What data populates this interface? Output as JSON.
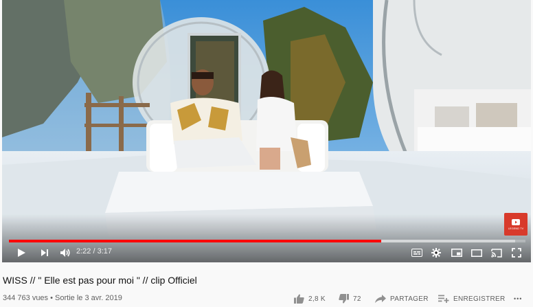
{
  "player": {
    "current_time": "2:22",
    "time_separator": " / ",
    "duration": "3:17",
    "progress_played_fraction": 0.721,
    "progress_loaded_fraction": 0.98,
    "watermark_text": "LEGEND TV"
  },
  "video": {
    "title": "WISS // \" Elle est pas pour moi \" // clip Officiel",
    "views": "344 763 vues",
    "separator": " • ",
    "release": "Sortie le 3 avr. 2019"
  },
  "actions": {
    "like_count": "2,8 K",
    "dislike_count": "72",
    "share_label": "PARTAGER",
    "save_label": "ENREGISTRER",
    "more_label": "•••"
  },
  "icons": [
    "play-icon",
    "next-icon",
    "volume-icon",
    "subtitles-icon",
    "settings-icon",
    "miniplayer-icon",
    "theater-icon",
    "cast-icon",
    "fullscreen-icon",
    "like-icon",
    "dislike-icon",
    "share-icon",
    "save-icon",
    "more-icon"
  ],
  "colors": {
    "progress_played": "#ff0000",
    "watermark": "#d83a2b"
  }
}
